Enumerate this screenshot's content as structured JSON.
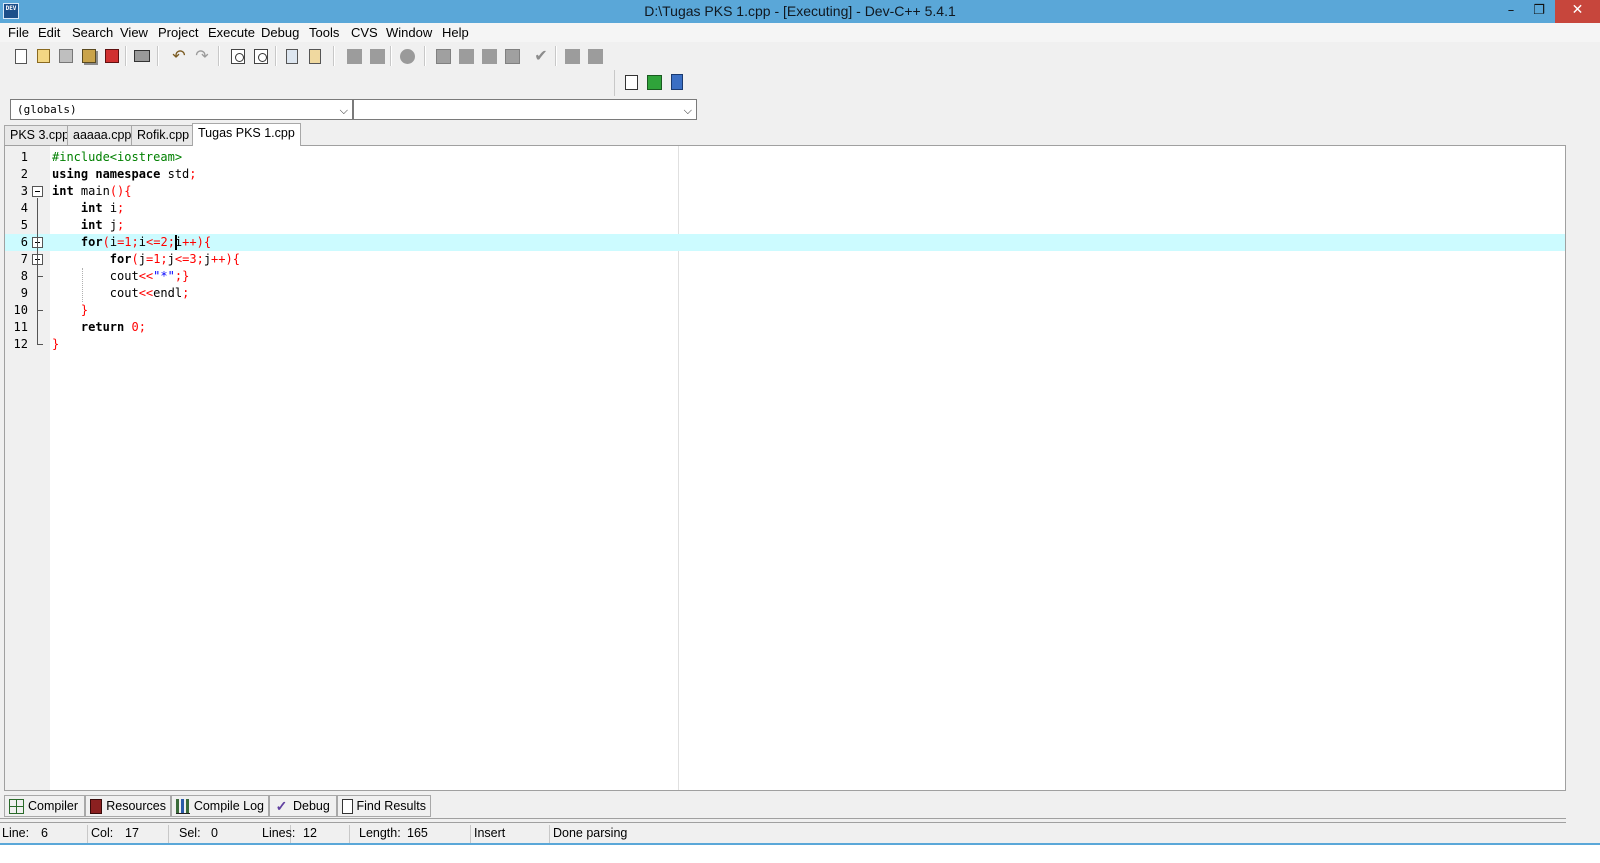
{
  "window": {
    "title": "D:\\Tugas PKS 1.cpp - [Executing] - Dev-C++ 5.4.1",
    "icon_text": "DEV",
    "minimize_glyph": "–",
    "maximize_glyph": "❐",
    "close_glyph": "✕"
  },
  "menu": [
    "File",
    "Edit",
    "Search",
    "View",
    "Project",
    "Execute",
    "Debug",
    "Tools",
    "CVS",
    "Window",
    "Help"
  ],
  "toolbar": {
    "icons": [
      "new-file-icon",
      "open-project-icon",
      "save-icon",
      "save-all-icon",
      "close-file-icon",
      "print-icon",
      "undo-icon",
      "redo-icon",
      "find-icon",
      "replace-icon",
      "indent-icon",
      "unindent-icon",
      "goto-back-icon",
      "goto-forward-icon",
      "bookmark-icon",
      "compile-icon",
      "run-icon",
      "compile-run-icon",
      "rebuild-icon",
      "syntax-check-icon",
      "debug-icon",
      "profile-icon"
    ],
    "secondary_icons": [
      "goto-line-icon",
      "add-to-project-icon",
      "insert-bookmark-icon"
    ]
  },
  "class_browser": {
    "scope_value": "(globals)",
    "member_value": ""
  },
  "tabs": [
    {
      "label": "PKS 3.cpp",
      "active": false
    },
    {
      "label": "aaaaa.cpp",
      "active": false
    },
    {
      "label": "Rofik.cpp",
      "active": false
    },
    {
      "label": "Tugas PKS 1.cpp",
      "active": true
    }
  ],
  "editor": {
    "line_numbers": [
      "1",
      "2",
      "3",
      "4",
      "5",
      "6",
      "7",
      "8",
      "9",
      "10",
      "11",
      "12"
    ],
    "current_line": 6,
    "lines": [
      "#include<iostream>",
      "using namespace std;",
      "int main(){",
      "    int i;",
      "    int j;",
      "    for(i=1;i<=2;i++){",
      "        for(j=1;j<=3;j++){",
      "        cout<<\"*\";}",
      "        cout<<endl;",
      "    }",
      "    return 0;",
      "}"
    ],
    "colors": {
      "keyword": "#000000",
      "preprocessor": "#008000",
      "symbol": "#ff0000",
      "string": "#0000ff",
      "current_line_bg": "#ccfbff"
    }
  },
  "bottom_tabs": [
    {
      "label": "Compiler",
      "icon": "compiler-grid-icon"
    },
    {
      "label": "Resources",
      "icon": "resources-icon"
    },
    {
      "label": "Compile Log",
      "icon": "compile-log-chart-icon"
    },
    {
      "label": "Debug",
      "icon": "debug-check-icon"
    },
    {
      "label": "Find Results",
      "icon": "find-results-icon"
    }
  ],
  "status": {
    "line_label": "Line:",
    "line_value": "6",
    "col_label": "Col:",
    "col_value": "17",
    "sel_label": "Sel:",
    "sel_value": "0",
    "lines_label": "Lines:",
    "lines_value": "12",
    "length_label": "Length:",
    "length_value": "165",
    "mode": "Insert",
    "message": "Done parsing"
  }
}
